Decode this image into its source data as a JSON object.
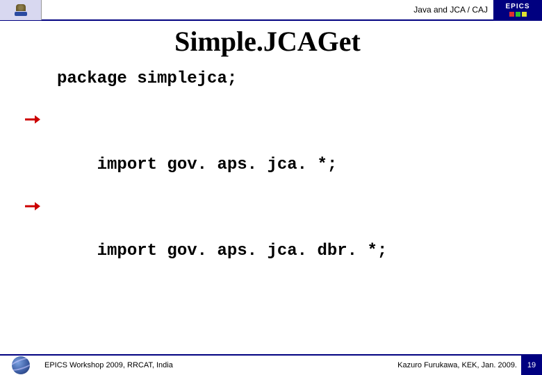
{
  "header": {
    "topic": "Java and JCA / CAJ",
    "brand": "EPICS"
  },
  "title": "Simple.JCAGet",
  "code": {
    "line1": "package simplejca;",
    "line2": "import gov. aps. jca. *;",
    "line3": "import gov. aps. jca. dbr. *;"
  },
  "footer": {
    "left": "EPICS Workshop 2009, RRCAT, India",
    "right": "Kazuro Furukawa, KEK, Jan. 2009.",
    "page": "19"
  }
}
